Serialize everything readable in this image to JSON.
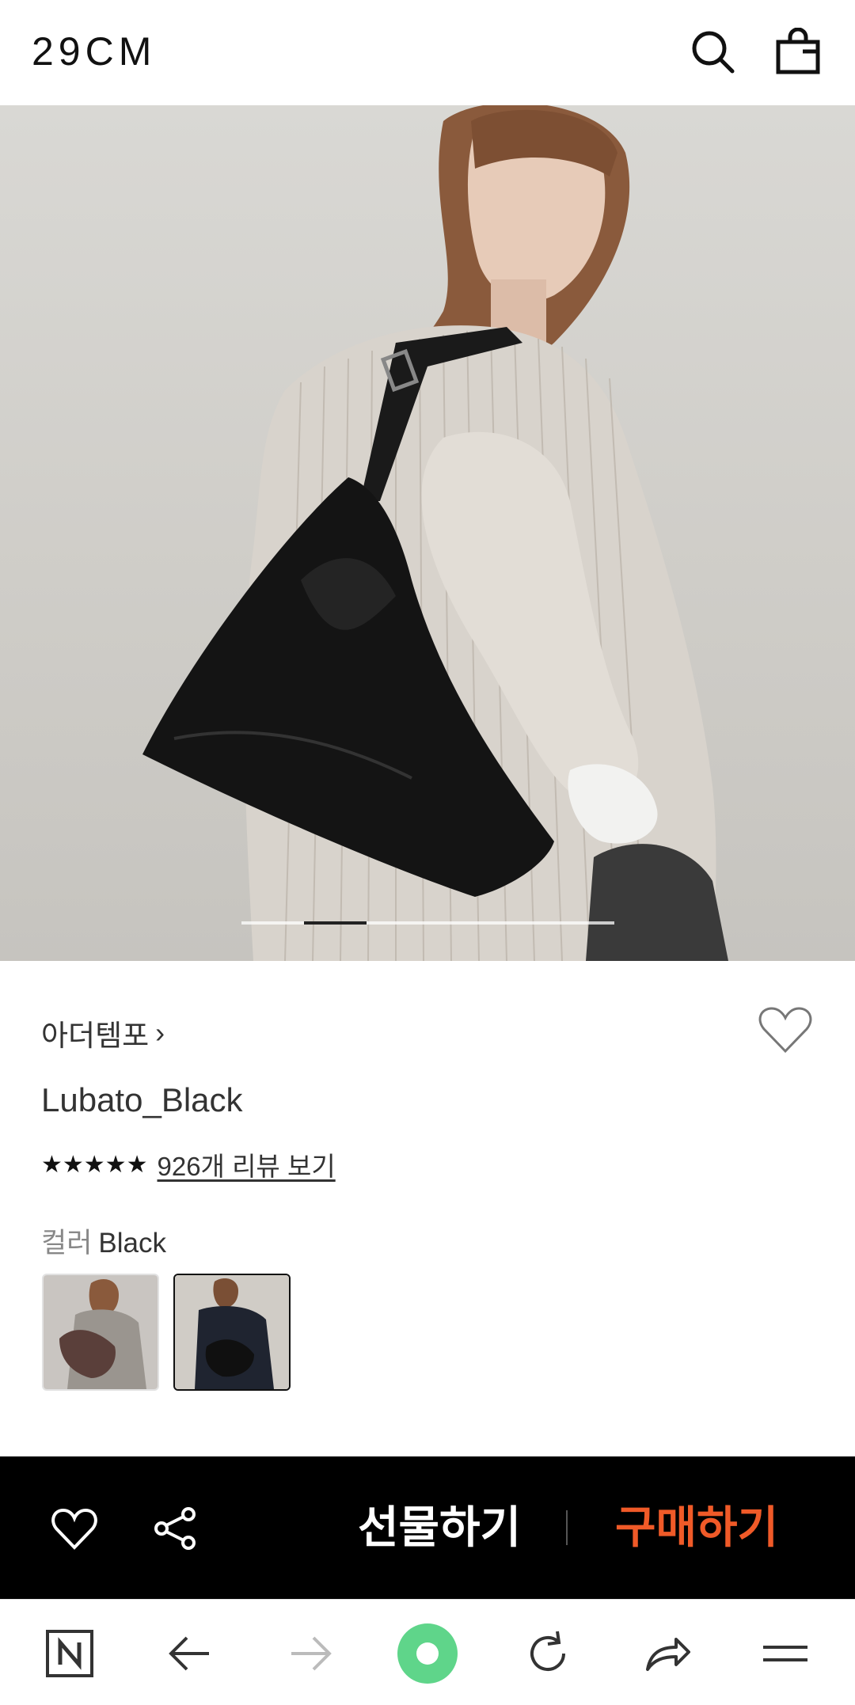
{
  "header": {
    "logo": "29CM",
    "icons": [
      "search-icon",
      "shopping-bag-icon"
    ]
  },
  "hero": {
    "slide_index": 2,
    "slide_count": 6
  },
  "product": {
    "brand": "아더템포",
    "brand_chevron": "›",
    "name": "Lubato_Black",
    "stars": "★★★★★",
    "rating_stars": 5,
    "review_link": "926개 리뷰 보기",
    "color_label": "컬러",
    "color_value": "Black",
    "color_options": [
      "brown-bag-swatch",
      "black-bag-swatch"
    ],
    "selected_color_index": 1
  },
  "action_bar": {
    "gift_label": "선물하기",
    "buy_label": "구매하기",
    "icons": [
      "heart-icon",
      "share-icon"
    ],
    "colors": {
      "background": "#000000",
      "buy": "#f05a28",
      "gift": "#ffffff"
    }
  },
  "browser_bar": {
    "icons": [
      "naver-icon",
      "back-arrow-icon",
      "forward-arrow-icon",
      "green-dot-icon",
      "refresh-icon",
      "share-arrow-icon",
      "menu-icon"
    ],
    "colors": {
      "dot": "#5fd58a"
    }
  }
}
